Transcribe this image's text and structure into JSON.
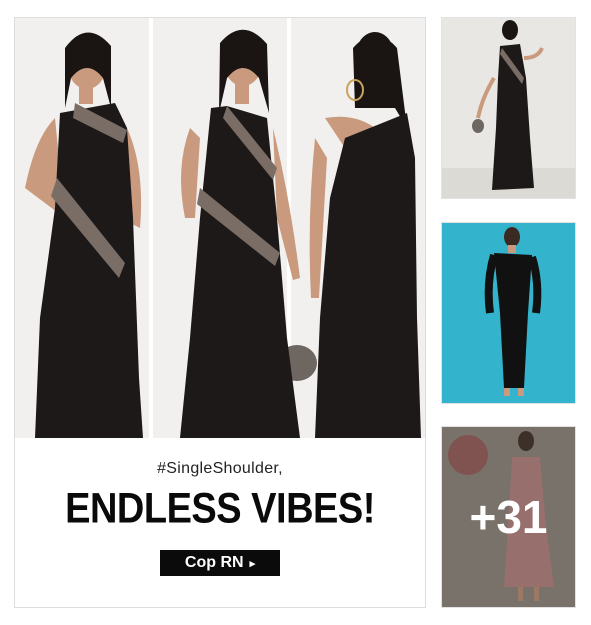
{
  "banner": {
    "tagline": "#SingleShoulder,",
    "headline": "ENDLESS VIBES!",
    "cta_label": "Cop RN",
    "cta_arrow": "▸"
  },
  "thumbnails": {
    "more_count": "+31"
  },
  "colors": {
    "dress": "#1c1918",
    "cta_background": "#0b0b0b",
    "thumb2_background": "#33b3cc"
  }
}
